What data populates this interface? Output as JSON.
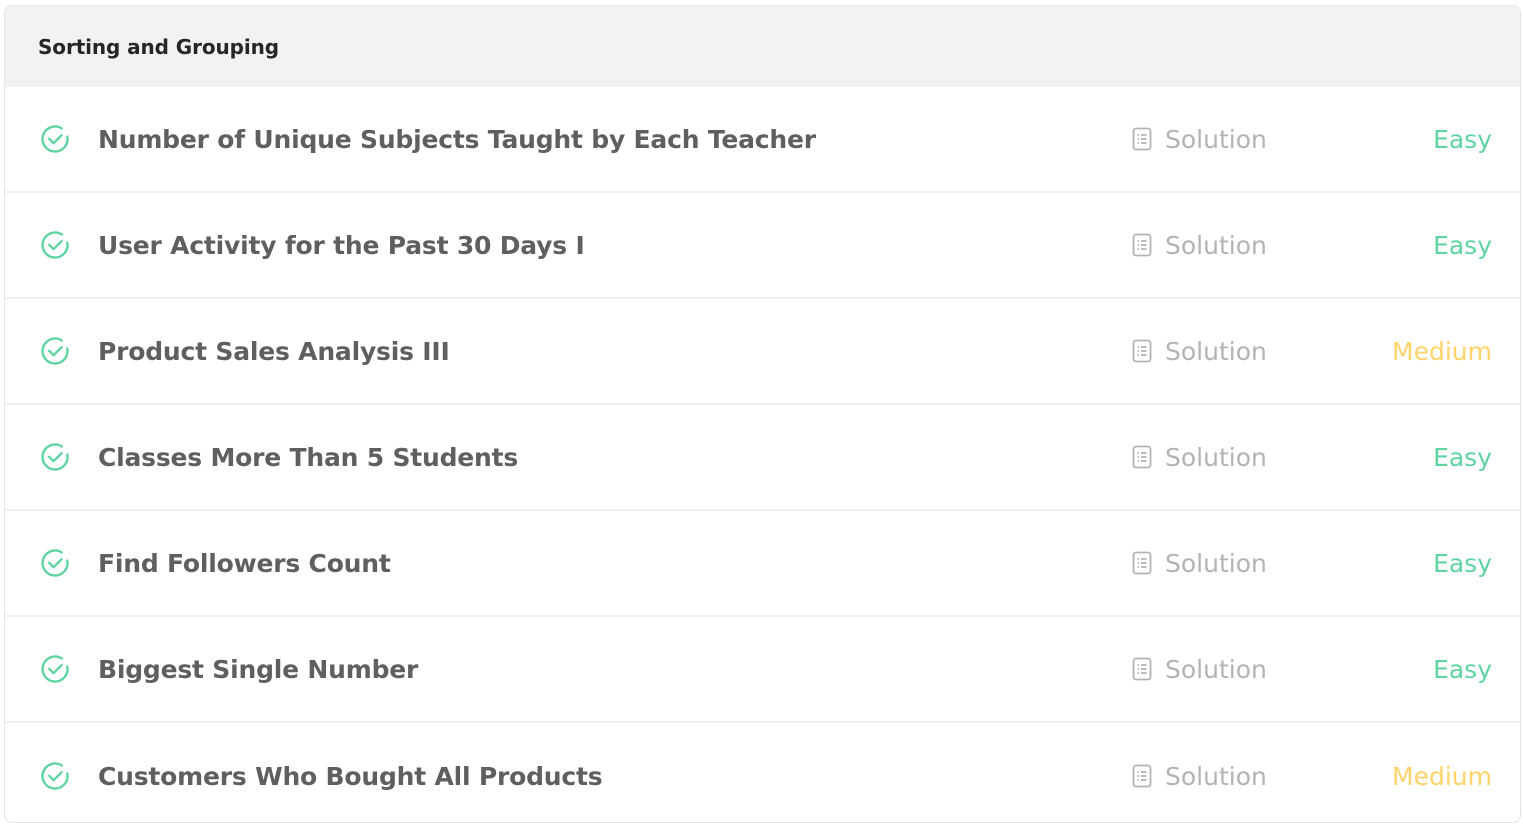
{
  "section": {
    "title": "Sorting and Grouping"
  },
  "colors": {
    "easy": "#5fd4a0",
    "medium": "#fdd36a",
    "check": "#5fd4a0"
  },
  "problems": [
    {
      "title": "Number of Unique Subjects Taught by Each Teacher",
      "solution_label": "Solution",
      "difficulty": "Easy",
      "status_icon": "check-circle-icon"
    },
    {
      "title": "User Activity for the Past 30 Days I",
      "solution_label": "Solution",
      "difficulty": "Easy",
      "status_icon": "check-circle-icon"
    },
    {
      "title": "Product Sales Analysis III",
      "solution_label": "Solution",
      "difficulty": "Medium",
      "status_icon": "check-circle-icon"
    },
    {
      "title": "Classes More Than 5 Students",
      "solution_label": "Solution",
      "difficulty": "Easy",
      "status_icon": "check-circle-icon"
    },
    {
      "title": "Find Followers Count",
      "solution_label": "Solution",
      "difficulty": "Easy",
      "status_icon": "check-circle-icon"
    },
    {
      "title": "Biggest Single Number",
      "solution_label": "Solution",
      "difficulty": "Easy",
      "status_icon": "check-circle-icon"
    },
    {
      "title": "Customers Who Bought All Products",
      "solution_label": "Solution",
      "difficulty": "Medium",
      "status_icon": "check-circle-icon"
    }
  ]
}
